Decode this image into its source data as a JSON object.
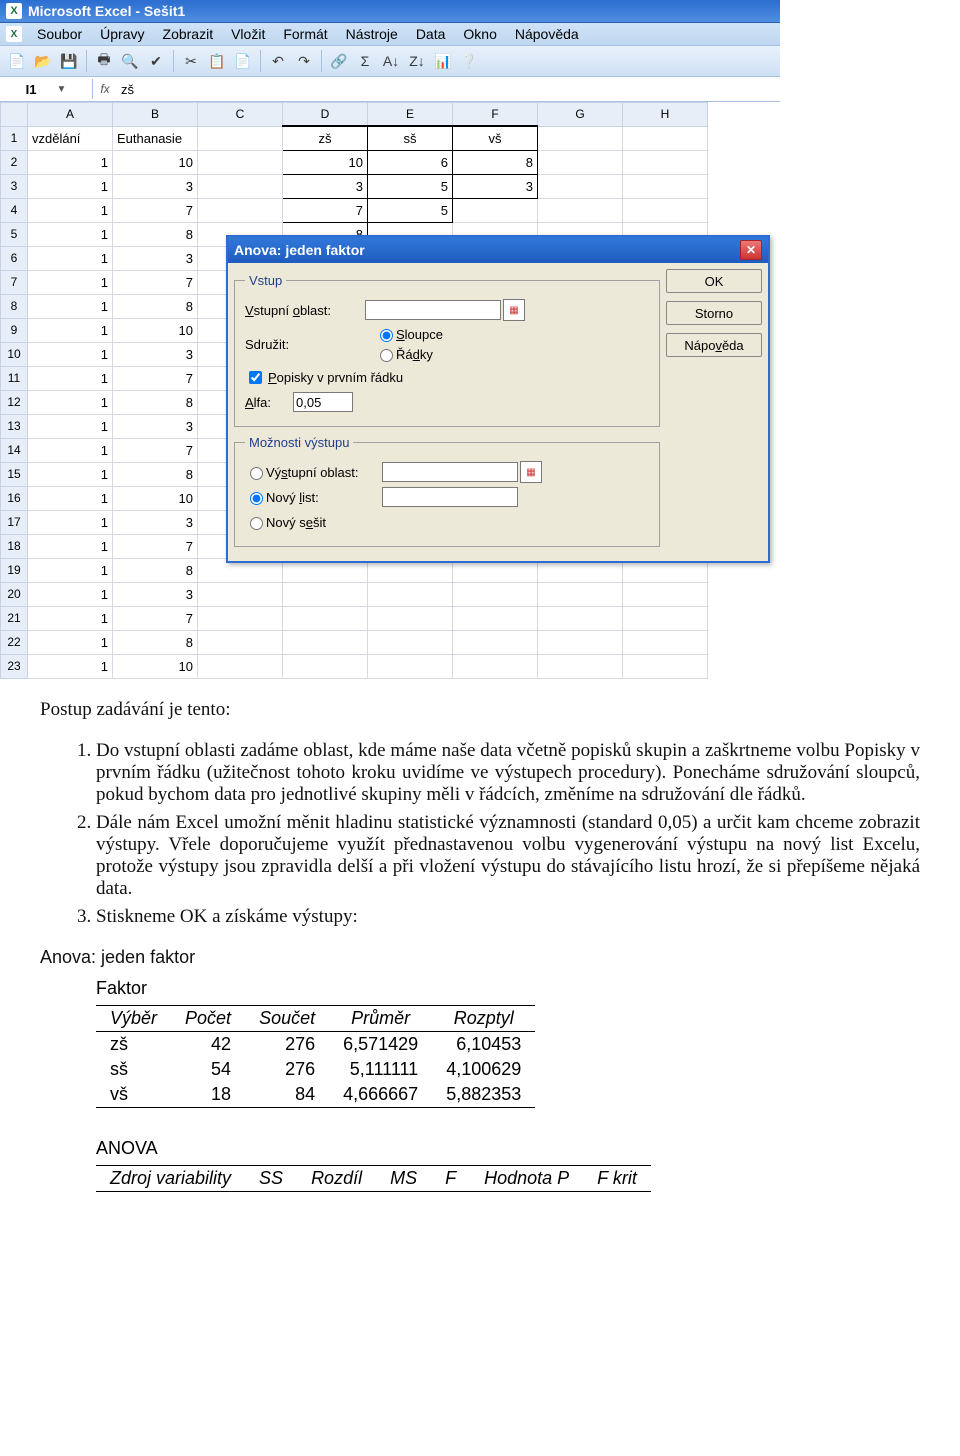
{
  "title": "Microsoft Excel - Sešit1",
  "menus": [
    "Soubor",
    "Úpravy",
    "Zobrazit",
    "Vložit",
    "Formát",
    "Nástroje",
    "Data",
    "Okno",
    "Nápověda"
  ],
  "toolbar_icons": [
    "📄",
    "📂",
    "💾",
    "🖶",
    "🔍",
    "✔",
    "✂",
    "📋",
    "📄",
    "↶",
    "↷",
    "🔗",
    "Σ",
    "A↓",
    "Z↓",
    "📊",
    "❔"
  ],
  "namebox": "I1",
  "formula_value": "zš",
  "columns": [
    "A",
    "B",
    "C",
    "D",
    "E",
    "F",
    "G",
    "H"
  ],
  "rows": [
    {
      "n": "1",
      "A": "vzdělání",
      "B": "Euthanasie",
      "C": "",
      "D": "zš",
      "E": "sš",
      "F": "vš",
      "G": "",
      "H": ""
    },
    {
      "n": "2",
      "A": "1",
      "B": "10",
      "C": "",
      "D": "10",
      "E": "6",
      "F": "8",
      "G": "",
      "H": ""
    },
    {
      "n": "3",
      "A": "1",
      "B": "3",
      "C": "",
      "D": "3",
      "E": "5",
      "F": "3",
      "G": "",
      "H": ""
    },
    {
      "n": "4",
      "A": "1",
      "B": "7",
      "C": "",
      "D": "7",
      "E": "5",
      "F": "",
      "G": "",
      "H": ""
    },
    {
      "n": "5",
      "A": "1",
      "B": "8",
      "C": "",
      "D": "8",
      "E": "",
      "F": "",
      "G": "",
      "H": ""
    },
    {
      "n": "6",
      "A": "1",
      "B": "3",
      "C": "",
      "D": "",
      "E": "",
      "F": "",
      "G": "",
      "H": ""
    },
    {
      "n": "7",
      "A": "1",
      "B": "7",
      "C": "",
      "D": "",
      "E": "",
      "F": "",
      "G": "",
      "H": ""
    },
    {
      "n": "8",
      "A": "1",
      "B": "8",
      "C": "",
      "D": "",
      "E": "",
      "F": "",
      "G": "",
      "H": ""
    },
    {
      "n": "9",
      "A": "1",
      "B": "10",
      "C": "",
      "D": "",
      "E": "",
      "F": "",
      "G": "",
      "H": ""
    },
    {
      "n": "10",
      "A": "1",
      "B": "3",
      "C": "",
      "D": "",
      "E": "",
      "F": "",
      "G": "",
      "H": ""
    },
    {
      "n": "11",
      "A": "1",
      "B": "7",
      "C": "",
      "D": "",
      "E": "",
      "F": "",
      "G": "",
      "H": ""
    },
    {
      "n": "12",
      "A": "1",
      "B": "8",
      "C": "",
      "D": "",
      "E": "",
      "F": "",
      "G": "",
      "H": ""
    },
    {
      "n": "13",
      "A": "1",
      "B": "3",
      "C": "",
      "D": "",
      "E": "",
      "F": "",
      "G": "",
      "H": ""
    },
    {
      "n": "14",
      "A": "1",
      "B": "7",
      "C": "",
      "D": "",
      "E": "",
      "F": "",
      "G": "",
      "H": ""
    },
    {
      "n": "15",
      "A": "1",
      "B": "8",
      "C": "",
      "D": "",
      "E": "",
      "F": "",
      "G": "",
      "H": ""
    },
    {
      "n": "16",
      "A": "1",
      "B": "10",
      "C": "",
      "D": "",
      "E": "",
      "F": "",
      "G": "",
      "H": ""
    },
    {
      "n": "17",
      "A": "1",
      "B": "3",
      "C": "",
      "D": "",
      "E": "",
      "F": "",
      "G": "",
      "H": ""
    },
    {
      "n": "18",
      "A": "1",
      "B": "7",
      "C": "",
      "D": "",
      "E": "",
      "F": "",
      "G": "",
      "H": ""
    },
    {
      "n": "19",
      "A": "1",
      "B": "8",
      "C": "",
      "D": "",
      "E": "",
      "F": "",
      "G": "",
      "H": ""
    },
    {
      "n": "20",
      "A": "1",
      "B": "3",
      "C": "",
      "D": "",
      "E": "",
      "F": "",
      "G": "",
      "H": ""
    },
    {
      "n": "21",
      "A": "1",
      "B": "7",
      "C": "",
      "D": "",
      "E": "",
      "F": "",
      "G": "",
      "H": ""
    },
    {
      "n": "22",
      "A": "1",
      "B": "8",
      "C": "",
      "D": "",
      "E": "",
      "F": "",
      "G": "",
      "H": ""
    },
    {
      "n": "23",
      "A": "1",
      "B": "10",
      "C": "",
      "D": "",
      "E": "",
      "F": "",
      "G": "",
      "H": ""
    }
  ],
  "dialog": {
    "title": "Anova: jeden faktor",
    "fs1": "Vstup",
    "vstupni_oblast": "Vstupní oblast:",
    "sdruzit": "Sdružit:",
    "sloupce": "Sloupce",
    "radky": "Řádky",
    "popisky": "Popisky v prvním řádku",
    "alfa_label": "Alfa:",
    "alfa_value": "0,05",
    "fs2": "Možnosti výstupu",
    "vyst_oblast": "Výstupní oblast:",
    "novy_list": "Nový list:",
    "novy_sesit": "Nový sešit",
    "ok": "OK",
    "storno": "Storno",
    "napoveda": "Nápověda"
  },
  "doc": {
    "heading": "Postup zadávání je tento:",
    "li1": "Do vstupní oblasti zadáme oblast, kde máme naše data včetně popisků skupin a zaškrtneme volbu Popisky v prvním řádku (užitečnost tohoto kroku uvidíme ve výstupech procedury). Ponecháme sdružování sloupců, pokud bychom data pro jednotlivé skupiny měli v řádcích, změníme na sdružování dle řádků.",
    "li2": "Dále nám Excel umožní měnit hladinu statistické významnosti (standard 0,05) a určit kam chceme zobrazit výstupy. Vřele doporučujeme využít přednastavenou volbu vygenerování výstupu na nový list Excelu, protože výstupy jsou zpravidla delší a při vložení výstupu do stávajícího listu hrozí, že si přepíšeme nějaká data.",
    "li3": "Stiskneme OK a získáme výstupy:",
    "anova_title": "Anova: jeden faktor"
  },
  "faktor": {
    "label": "Faktor",
    "cols": [
      "Výběr",
      "Počet",
      "Součet",
      "Průměr",
      "Rozptyl"
    ],
    "rows": [
      [
        "zš",
        "42",
        "276",
        "6,571429",
        "6,10453"
      ],
      [
        "sš",
        "54",
        "276",
        "5,111111",
        "4,100629"
      ],
      [
        "vš",
        "18",
        "84",
        "4,666667",
        "5,882353"
      ]
    ]
  },
  "anova": {
    "label": "ANOVA",
    "row1": [
      "Zdroj variability",
      "SS",
      "Rozdíl",
      "MS",
      "F",
      "Hodnota P",
      "F krit"
    ]
  }
}
